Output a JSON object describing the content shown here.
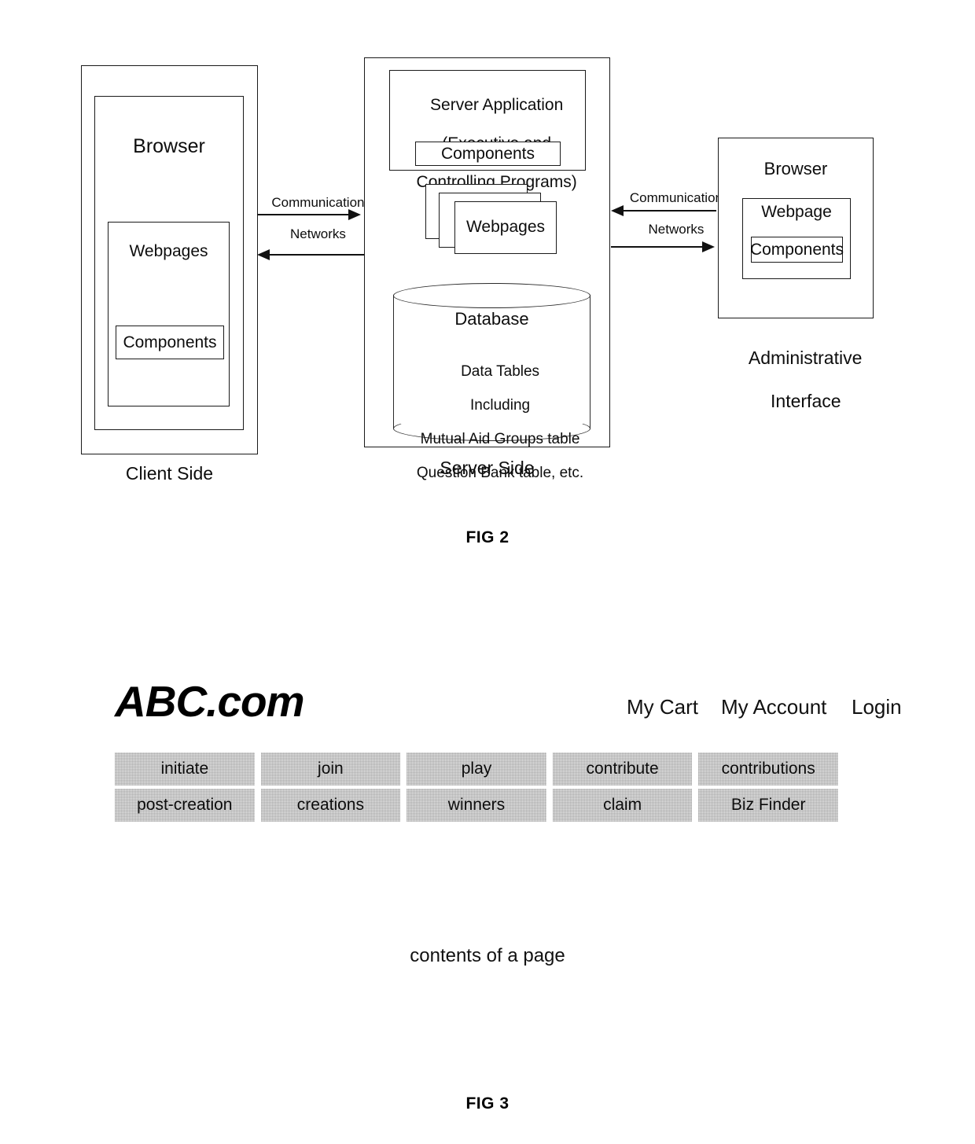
{
  "figure2": {
    "caption": "FIG 2",
    "client": {
      "outer_label": "Client Side",
      "browser_label": "Browser",
      "webpages_label": "Webpages",
      "components_label": "Components"
    },
    "link_left": {
      "line1": "Communication",
      "line2": "Networks"
    },
    "server": {
      "outer_label": "Server Side",
      "app_line1": "Server Application",
      "app_line2": "(Executive and",
      "app_line3": "Controlling Programs)",
      "app_components_label": "Components",
      "webpages_label": "Webpages",
      "database_title": "Database",
      "database_line1": "Data Tables",
      "database_line2": "Including",
      "database_line3": "Mutual Aid Groups table",
      "database_line4": "Question Bank table, etc."
    },
    "link_right": {
      "line1": "Communication",
      "line2": "Networks"
    },
    "admin": {
      "caption_line1": "Administrative",
      "caption_line2": "Interface",
      "browser_label": "Browser",
      "webpage_label": "Webpage",
      "components_label": "Components"
    }
  },
  "figure3": {
    "caption": "FIG 3",
    "brand": "ABC.com",
    "top_links": [
      "My Cart",
      "My Account",
      "Login"
    ],
    "nav_tabs": [
      "initiate",
      "join",
      "play",
      "contribute",
      "contributions",
      "post-creation",
      "creations",
      "winners",
      "claim",
      "Biz Finder"
    ],
    "page_contents_label": "contents of a page"
  },
  "colors": {
    "ink": "#000000",
    "tab_fill": "#e3e3e3"
  }
}
